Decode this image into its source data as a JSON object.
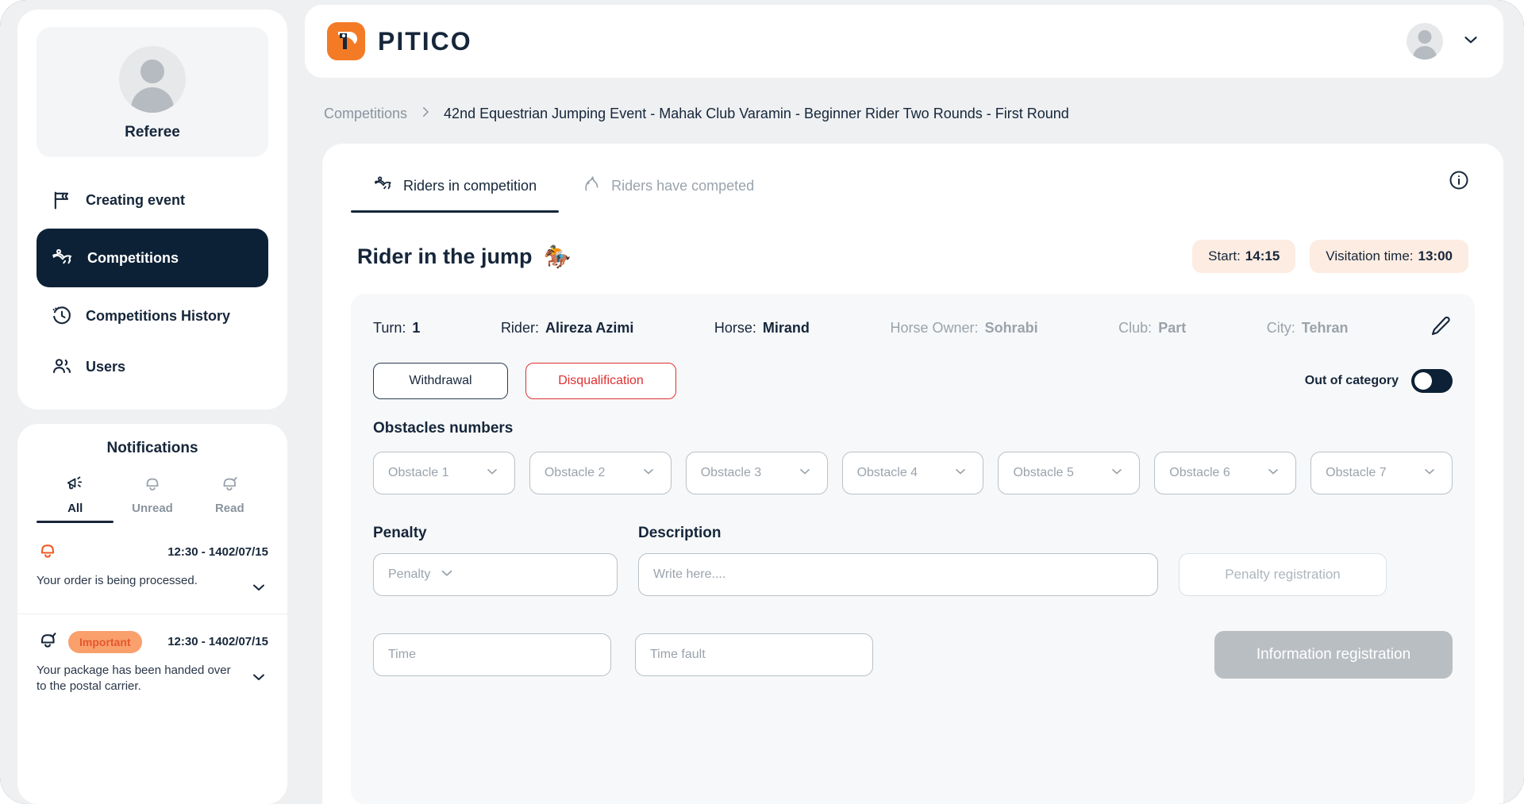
{
  "sidebar": {
    "profile": {
      "role": "Referee",
      "avatar_icon": "user-avatar-icon"
    },
    "items": [
      {
        "label": "Creating event",
        "icon": "flag-icon",
        "active": false
      },
      {
        "label": "Competitions",
        "icon": "horse-rider-icon",
        "active": true
      },
      {
        "label": "Competitions History",
        "icon": "clock-history-icon",
        "active": false
      },
      {
        "label": "Users",
        "icon": "users-icon",
        "active": false
      }
    ],
    "notifications": {
      "title": "Notifications",
      "tabs": [
        {
          "label": "All",
          "icon": "megaphone-icon",
          "active": true
        },
        {
          "label": "Unread",
          "icon": "bell-icon",
          "active": false
        },
        {
          "label": "Read",
          "icon": "bell-check-icon",
          "active": false
        }
      ],
      "items": [
        {
          "icon": "bell-icon",
          "badge": "",
          "time": "12:30 - 1402/07/15",
          "text": "Your order is being processed."
        },
        {
          "icon": "bell-check-icon",
          "badge": "Important",
          "time": "12:30 - 1402/07/15",
          "text": "Your package has been handed over to the postal carrier."
        }
      ]
    }
  },
  "topbar": {
    "brand_name": "PITICO",
    "logo_icon": "pitico-logo-icon",
    "avatar_icon": "user-avatar-icon",
    "chevron_icon": "chevron-down-icon"
  },
  "breadcrumb": {
    "root": "Competitions",
    "separator": "›",
    "current": "42nd Equestrian Jumping Event - Mahak Club Varamin - Beginner Rider Two Rounds - First Round"
  },
  "tabs": [
    {
      "label": "Riders in competition",
      "icon": "horse-rider-icon",
      "active": true
    },
    {
      "label": "Riders have competed",
      "icon": "horse-head-icon",
      "active": false
    }
  ],
  "info_icon": "info-circle-icon",
  "section": {
    "title": "Rider in the jump",
    "emoji": "🏇",
    "badges": [
      {
        "label": "Start:",
        "value": "14:15"
      },
      {
        "label": "Visitation time:",
        "value": "13:00"
      }
    ]
  },
  "rider": {
    "fields": [
      {
        "key": "Turn:",
        "value": "1",
        "muted": false
      },
      {
        "key": "Rider:",
        "value": "Alireza Azimi",
        "muted": false
      },
      {
        "key": "Horse:",
        "value": "Mirand",
        "muted": false
      },
      {
        "key": "Horse Owner:",
        "value": "Sohrabi",
        "muted": true
      },
      {
        "key": "Club:",
        "value": "Part",
        "muted": true
      },
      {
        "key": "City:",
        "value": "Tehran",
        "muted": true
      }
    ],
    "edit_icon": "pencil-edit-icon"
  },
  "actions": {
    "withdrawal": "Withdrawal",
    "disqualification": "Disqualification",
    "out_of_category_label": "Out of category",
    "out_of_category_on": true
  },
  "obstacles": {
    "label": "Obstacles numbers",
    "items": [
      "Obstacle 1",
      "Obstacle 2",
      "Obstacle 3",
      "Obstacle 4",
      "Obstacle 5",
      "Obstacle 6",
      "Obstacle 7"
    ],
    "chevron_icon": "chevron-down-icon"
  },
  "form": {
    "penalty_label": "Penalty",
    "penalty_placeholder": "Penalty",
    "description_label": "Description",
    "description_placeholder": "Write here....",
    "penalty_registration": "Penalty registration",
    "time_placeholder": "Time",
    "time_fault_placeholder": "Time fault",
    "information_registration": "Information registration"
  },
  "colors": {
    "navy": "#0d2136",
    "orange": "#f47b26",
    "badge_bg": "#fdece1",
    "danger": "#e03131",
    "muted": "#9aa3ac",
    "important_badge": "#f9a06c",
    "primary_disabled": "#b9bec3"
  }
}
